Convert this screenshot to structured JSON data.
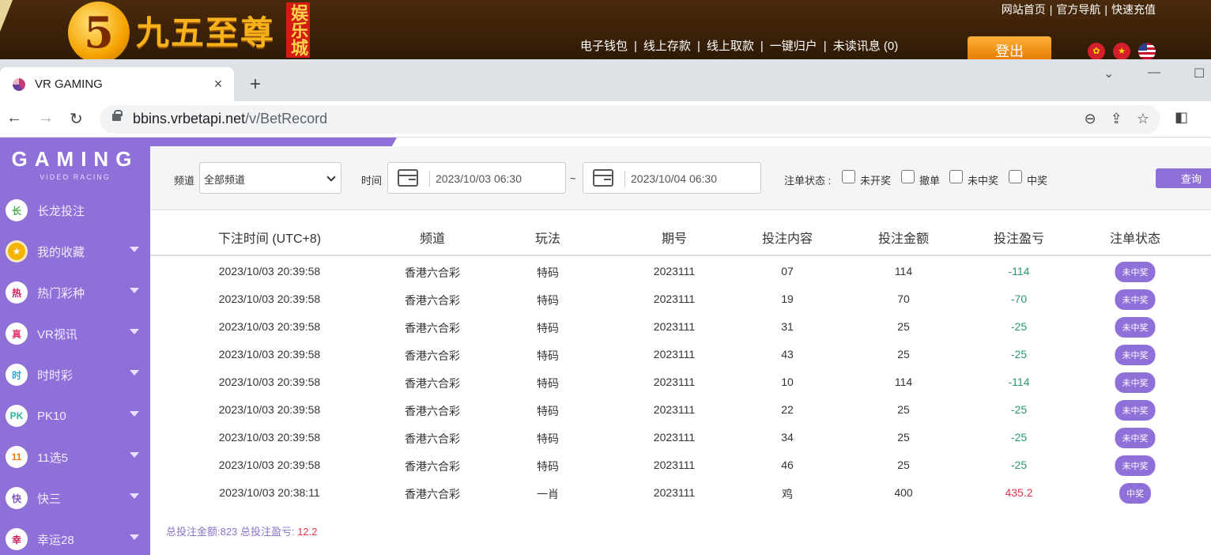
{
  "banner": {
    "logo_digit": "5",
    "logo_text": "九五至尊",
    "logo_tag": "娱乐城",
    "top_links": [
      "网站首页",
      "官方导航",
      "快速充值"
    ],
    "main_links": [
      "电子钱包",
      "线上存款",
      "线上取款",
      "一键归户",
      "未读讯息 (0)"
    ],
    "logout": "登出",
    "link_separator": "|"
  },
  "browser": {
    "tab_title": "VR GAMING",
    "url_host": "bbins.vrbetapi.net",
    "url_path": "/v/BetRecord",
    "new_tab": "+",
    "close": "×"
  },
  "sidebar": {
    "brand": "GAMING",
    "brand_sub": "VIDEO RACING",
    "items": [
      {
        "icon": "长",
        "label": "长龙投注",
        "color": "#4caf50",
        "expand": false
      },
      {
        "icon": "★",
        "label": "我的收藏",
        "color": "#f4b400",
        "expand": true
      },
      {
        "icon": "热",
        "label": "热门彩种",
        "color": "#d81b60",
        "expand": true
      },
      {
        "icon": "真",
        "label": "VR视讯",
        "color": "#e53973",
        "expand": true
      },
      {
        "icon": "时",
        "label": "时时彩",
        "color": "#29a8e0",
        "expand": true
      },
      {
        "icon": "PK",
        "label": "PK10",
        "color": "#2bb59a",
        "expand": true
      },
      {
        "icon": "11",
        "label": "11选5",
        "color": "#f57c00",
        "expand": true
      },
      {
        "icon": "快",
        "label": "快三",
        "color": "#7e57c2",
        "expand": true
      },
      {
        "icon": "幸",
        "label": "幸运28",
        "color": "#c2185b",
        "expand": true
      }
    ]
  },
  "filters": {
    "channel_label": "频道",
    "channel_value": "全部频道",
    "time_label": "时间",
    "start": "2023/10/03 06:30",
    "tilde": "~",
    "end": "2023/10/04 06:30",
    "status_label": "注单状态 :",
    "statuses": [
      "未开奖",
      "撤单",
      "未中奖",
      "中奖"
    ],
    "query": "查询"
  },
  "table": {
    "headers": [
      "下注时间 (UTC+8)",
      "频道",
      "玩法",
      "期号",
      "投注内容",
      "投注金额",
      "投注盈亏",
      "注单状态"
    ],
    "rows": [
      {
        "time": "2023/10/03 20:39:58",
        "channel": "香港六合彩",
        "play": "特码",
        "issue": "2023111",
        "content": "07",
        "amount": "114",
        "pl": "-114",
        "status": "未中奖"
      },
      {
        "time": "2023/10/03 20:39:58",
        "channel": "香港六合彩",
        "play": "特码",
        "issue": "2023111",
        "content": "19",
        "amount": "70",
        "pl": "-70",
        "status": "未中奖"
      },
      {
        "time": "2023/10/03 20:39:58",
        "channel": "香港六合彩",
        "play": "特码",
        "issue": "2023111",
        "content": "31",
        "amount": "25",
        "pl": "-25",
        "status": "未中奖"
      },
      {
        "time": "2023/10/03 20:39:58",
        "channel": "香港六合彩",
        "play": "特码",
        "issue": "2023111",
        "content": "43",
        "amount": "25",
        "pl": "-25",
        "status": "未中奖"
      },
      {
        "time": "2023/10/03 20:39:58",
        "channel": "香港六合彩",
        "play": "特码",
        "issue": "2023111",
        "content": "10",
        "amount": "114",
        "pl": "-114",
        "status": "未中奖"
      },
      {
        "time": "2023/10/03 20:39:58",
        "channel": "香港六合彩",
        "play": "特码",
        "issue": "2023111",
        "content": "22",
        "amount": "25",
        "pl": "-25",
        "status": "未中奖"
      },
      {
        "time": "2023/10/03 20:39:58",
        "channel": "香港六合彩",
        "play": "特码",
        "issue": "2023111",
        "content": "34",
        "amount": "25",
        "pl": "-25",
        "status": "未中奖"
      },
      {
        "time": "2023/10/03 20:39:58",
        "channel": "香港六合彩",
        "play": "特码",
        "issue": "2023111",
        "content": "46",
        "amount": "25",
        "pl": "-25",
        "status": "未中奖"
      },
      {
        "time": "2023/10/03 20:38:11",
        "channel": "香港六合彩",
        "play": "一肖",
        "issue": "2023111",
        "content": "鸡",
        "amount": "400",
        "pl": "435.2",
        "status": "中奖"
      }
    ]
  },
  "summary": {
    "total_bet": "总投注金额:823",
    "total_pl_label": "总投注盈亏:",
    "total_pl": "12.2"
  },
  "colors": {
    "accent": "#8f6fd8",
    "loss": "#2a9a6b",
    "win": "#e0354a"
  }
}
